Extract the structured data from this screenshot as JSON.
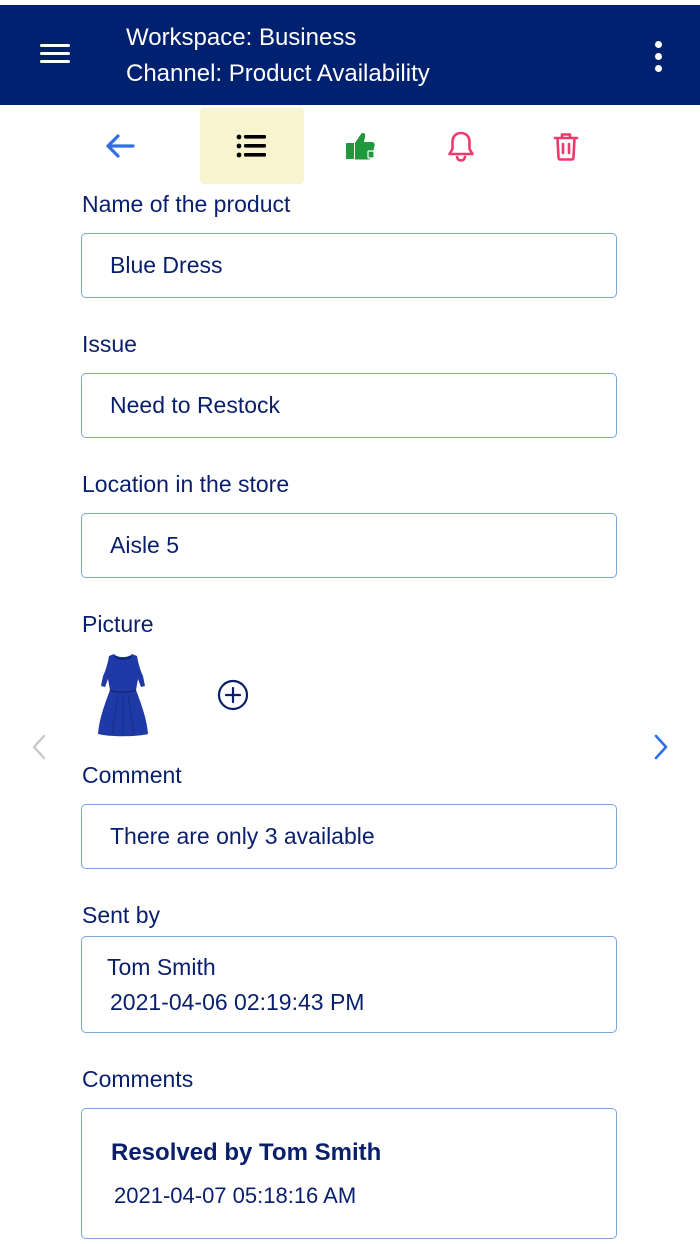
{
  "header": {
    "workspace": "Workspace: Business",
    "channel": "Channel: Product Availability",
    "menu_icon": "hamburger-menu-icon",
    "more_icon": "vertical-dots-icon"
  },
  "toolbar": {
    "items": [
      {
        "icon": "back-arrow-icon",
        "color": "#2f6fe0"
      },
      {
        "icon": "list-icon",
        "color": "#000000",
        "active": true
      },
      {
        "icon": "thumbs-up-icon",
        "color": "#1e9a3c"
      },
      {
        "icon": "bell-icon",
        "color": "#ee3a6a"
      },
      {
        "icon": "trash-icon",
        "color": "#ee3a6a"
      }
    ],
    "active_background": "#f8f4cf"
  },
  "form": {
    "product_label": "Name of the product",
    "product_value": "Blue Dress",
    "issue_label": "Issue",
    "issue_value": "Need to Restock",
    "location_label": "Location in the store",
    "location_value": "Aisle 5",
    "picture_label": "Picture",
    "picture_icon": "dress-thumbnail",
    "add_picture_icon": "add-circle-icon",
    "comment_label": "Comment",
    "comment_value": "There are only 3 available",
    "sent_by_label": "Sent by",
    "sent_by_name": "Tom Smith",
    "sent_by_time": "2021-04-06 02:19:43 PM",
    "comments_label": "Comments",
    "comments": [
      {
        "title": "Resolved by Tom Smith",
        "time": "2021-04-07 05:18:16 AM"
      }
    ]
  },
  "nav": {
    "prev_icon": "chevron-left-icon",
    "next_icon": "chevron-right-icon"
  },
  "colors": {
    "header_bg": "#002070",
    "text": "#0a1f6b",
    "field_border": "#7ea4dc",
    "accent_blue": "#2f6fe0"
  }
}
